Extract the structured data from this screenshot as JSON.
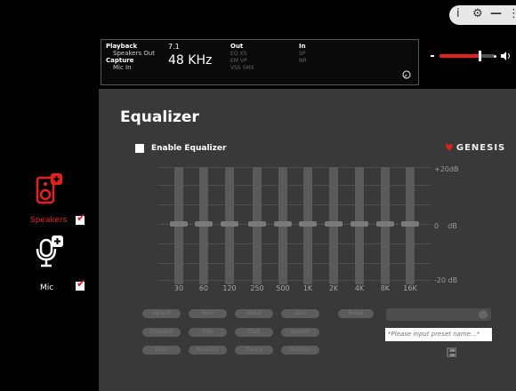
{
  "window_controls": {
    "info_icon": "i",
    "gear_icon": "⚙",
    "minimize_icon": "—",
    "more_icon": "⋮"
  },
  "info_panel": {
    "playback_label": "Playback",
    "playback_device": "Speakers Out",
    "capture_label": "Capture",
    "capture_device": "Mic In",
    "channels": "7.1",
    "sample_rate": "48 KHz",
    "out_label": "Out",
    "out_row1": "EQ   XS",
    "out_row2": "EM   VP",
    "out_row3": "VSS  SMX",
    "in_label": "In",
    "in_row1": "SP",
    "in_row2": "NR"
  },
  "volume": {
    "level": 0.72,
    "accent": "#e8201c"
  },
  "equalizer": {
    "title": "Equalizer",
    "enable_label": "Enable Equalizer",
    "enabled": false,
    "brand": "GENESIS",
    "db_top": "+20dB",
    "db_mid": "0    dB",
    "db_bottom": "-20 dB",
    "bands": [
      {
        "freq": "30",
        "gain": 0
      },
      {
        "freq": "60",
        "gain": 0
      },
      {
        "freq": "120",
        "gain": 0
      },
      {
        "freq": "250",
        "gain": 0
      },
      {
        "freq": "500",
        "gain": 0
      },
      {
        "freq": "1K",
        "gain": 0
      },
      {
        "freq": "2K",
        "gain": 0
      },
      {
        "freq": "4K",
        "gain": 0
      },
      {
        "freq": "8K",
        "gain": 0
      },
      {
        "freq": "16K",
        "gain": 0
      }
    ]
  },
  "presets": {
    "row1": [
      "Default",
      "Rock",
      "Metal",
      "Jazz"
    ],
    "row2": [
      "Classical",
      "Pop",
      "Club",
      "Speech"
    ],
    "row3": [
      "Bass",
      "Acoustic",
      "Dance",
      "Outdoor"
    ],
    "extra": "Reset",
    "input_placeholder": "*Please input preset name...*"
  },
  "devices": [
    {
      "label": "Speakers",
      "color": "#e8201c",
      "checked": true
    },
    {
      "label": "Mic",
      "color": "#ffffff",
      "checked": true
    }
  ]
}
